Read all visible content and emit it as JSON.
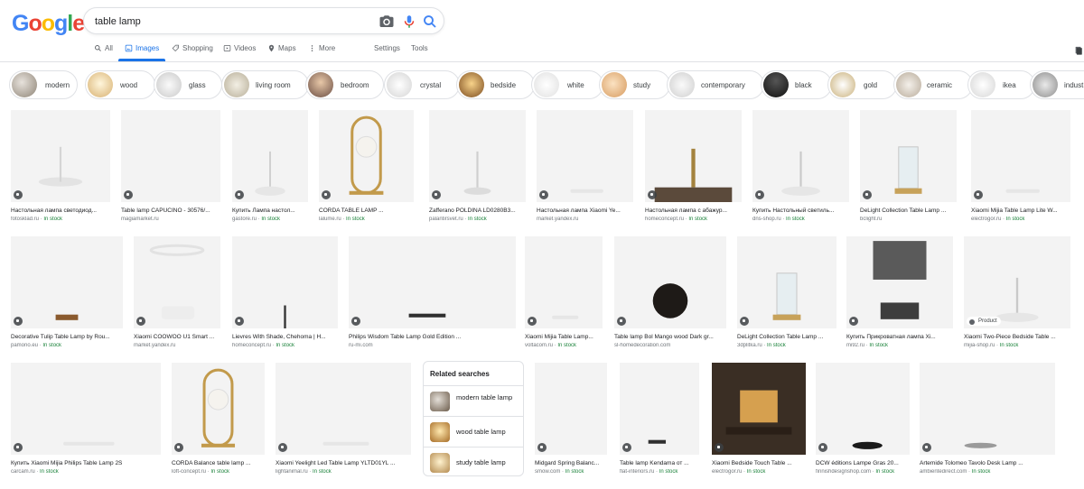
{
  "logo": "Google",
  "search": {
    "value": "table lamp"
  },
  "nav": {
    "all": "All",
    "images": "Images",
    "shopping": "Shopping",
    "videos": "Videos",
    "maps": "Maps",
    "more": "More",
    "settings": "Settings",
    "tools": "Tools"
  },
  "chips": [
    "modern",
    "wood",
    "glass",
    "living room",
    "bedroom",
    "crystal",
    "bedside",
    "white",
    "study",
    "contemporary",
    "black",
    "gold",
    "ceramic",
    "ikea",
    "indust"
  ],
  "results": [
    {
      "caption": "Настольная лампа светодиод...",
      "source": "fotosklad.ru",
      "stock": "In stock"
    },
    {
      "caption": "Table lamp CAPUCINO - 30576/...",
      "source": "magiamarket.ru",
      "stock": ""
    },
    {
      "caption": "Купить Лампа настол...",
      "source": "gastore.ru",
      "stock": "In stock"
    },
    {
      "caption": "CORDA TABLE LAMP ...",
      "source": "lalume.ru",
      "stock": "In stock"
    },
    {
      "caption": "Zafferano POLDINA LD0280B3...",
      "source": "palantirsvet.ru",
      "stock": "In stock"
    },
    {
      "caption": "Настольная лампа Xiaomi Ye...",
      "source": "market.yandex.ru",
      "stock": ""
    },
    {
      "caption": "Настольная лампа с абажур...",
      "source": "homeconcept.ru",
      "stock": "In stock"
    },
    {
      "caption": "Купить Настольный светиль...",
      "source": "dns-shop.ru",
      "stock": "In stock"
    },
    {
      "caption": "DeLight Collection Table Lamp ...",
      "source": "bclight.ru",
      "stock": ""
    },
    {
      "caption": "Xiaomi Mijia Table Lamp Lite W...",
      "source": "electrogor.ru",
      "stock": "In stock"
    },
    {
      "caption": "Decorative Tulip Table Lamp by Rou...",
      "source": "pamono.eu",
      "stock": "In stock"
    },
    {
      "caption": "Xiaomi COOWOO U1 Smart ...",
      "source": "market.yandex.ru",
      "stock": ""
    },
    {
      "caption": "Lievres With Shade, Chehoma | H...",
      "source": "homeconcept.ru",
      "stock": "In stock"
    },
    {
      "caption": "Philips Wisdom Table Lamp Gold Edition ...",
      "source": "ru-mi.com",
      "stock": ""
    },
    {
      "caption": "Xiaomi Mijia Table Lamp...",
      "source": "voltacom.ru",
      "stock": "In stock"
    },
    {
      "caption": "Table lamp Bol Mango wood Dark gr...",
      "source": "sl-homedecoration.com",
      "stock": ""
    },
    {
      "caption": "DeLight Collection Table Lamp ...",
      "source": "3dplitka.ru",
      "stock": "In stock"
    },
    {
      "caption": "Купить Прикроватная лампа Xi...",
      "source": "mi92.ru",
      "stock": "In stock"
    },
    {
      "caption": "Xiaomi Two-Piece Bedside Table ...",
      "source": "mijia-shop.ru",
      "stock": "In stock"
    },
    {
      "caption": "Купить Xiaomi Mijia Philips Table Lamp 2S",
      "source": "carcam.ru",
      "stock": "In stock"
    },
    {
      "caption": "CORDA Balance table lamp ...",
      "source": "loft-concept.ru",
      "stock": "In stock"
    },
    {
      "caption": "Xiaomi Yeelight Led Table Lamp YLTD01YL ...",
      "source": "lightanimal.ru",
      "stock": "In stock"
    },
    {
      "caption": "Midgard Spring Balanc...",
      "source": "smow.com",
      "stock": "In stock"
    },
    {
      "caption": "Table lamp Kendama от ...",
      "source": "flat-interiors.ru",
      "stock": "In stock"
    },
    {
      "caption": "Xiaomi Bedside Touch Table ...",
      "source": "electrogor.ru",
      "stock": "In stock"
    },
    {
      "caption": "DCW éditions Lampe Gras 20...",
      "source": "finnishdesignshop.com",
      "stock": "In stock"
    },
    {
      "caption": "Artemide Tolomeo Tavolo Desk Lamp ...",
      "source": "ambientedirect.com",
      "stock": "In stock"
    }
  ],
  "product_badge": "Product",
  "related": {
    "title": "Related searches",
    "items": [
      "modern table lamp",
      "wood table lamp",
      "study table lamp"
    ]
  },
  "colors": {
    "accent": "#1a73e8",
    "in_stock": "#188038"
  }
}
